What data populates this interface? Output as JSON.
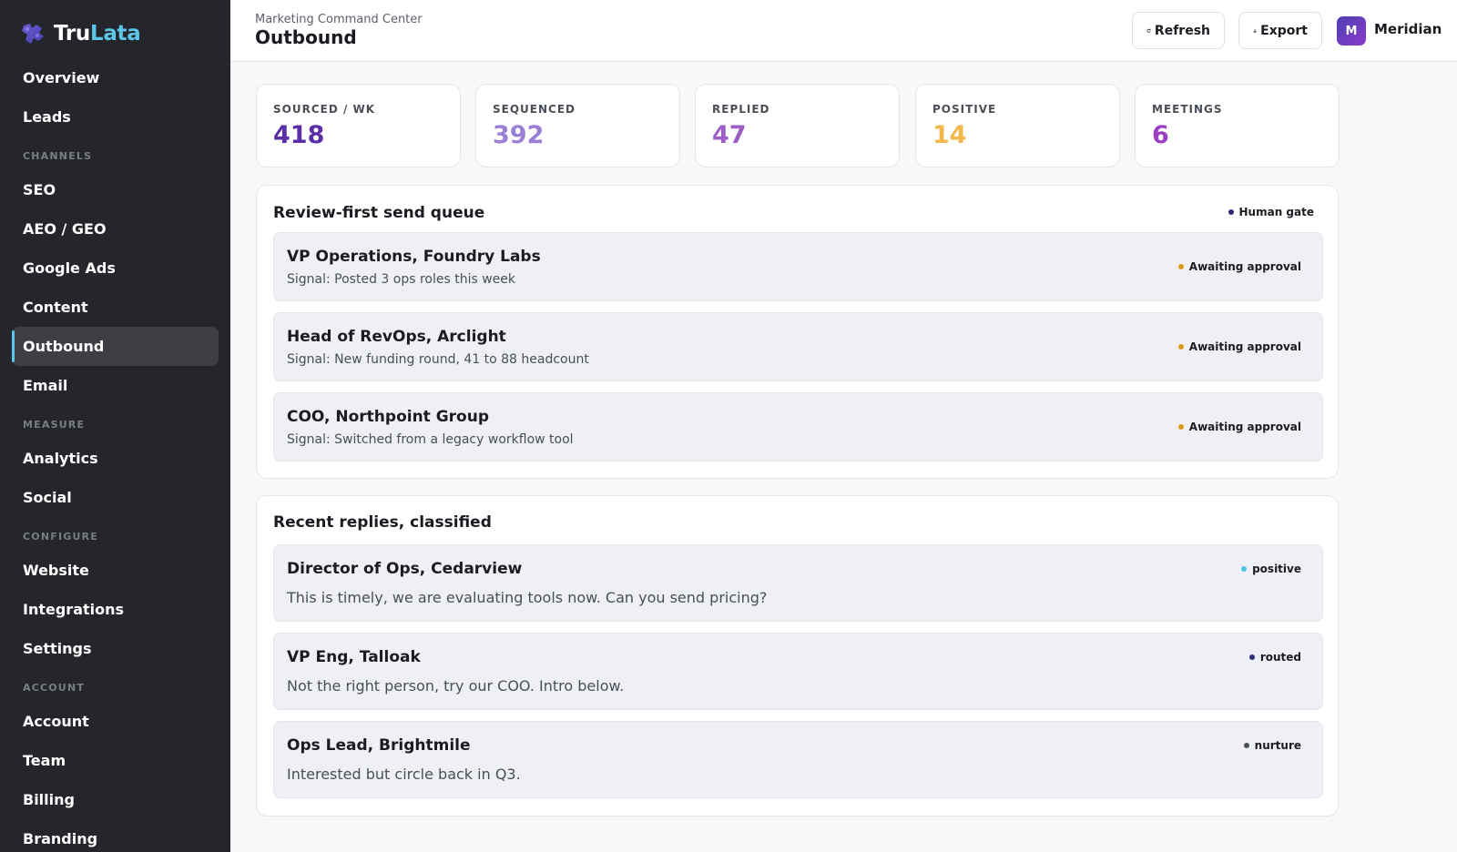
{
  "brand": {
    "name_part1": "Tru",
    "name_part2": "Lata",
    "logo_icon": "puzzle-logo-icon",
    "accent_color": "#5cc6e8"
  },
  "sidebar": {
    "items_top": [
      {
        "label": "Overview"
      },
      {
        "label": "Leads"
      }
    ],
    "sections": [
      {
        "heading": "CHANNELS",
        "items": [
          {
            "label": "SEO"
          },
          {
            "label": "AEO / GEO"
          },
          {
            "label": "Google Ads"
          },
          {
            "label": "Content"
          },
          {
            "label": "Outbound",
            "active": true
          },
          {
            "label": "Email"
          }
        ]
      },
      {
        "heading": "MEASURE",
        "items": [
          {
            "label": "Analytics"
          },
          {
            "label": "Social"
          }
        ]
      },
      {
        "heading": "CONFIGURE",
        "items": [
          {
            "label": "Website"
          },
          {
            "label": "Integrations"
          },
          {
            "label": "Settings"
          }
        ]
      },
      {
        "heading": "ACCOUNT",
        "items": [
          {
            "label": "Account"
          },
          {
            "label": "Team"
          },
          {
            "label": "Billing"
          },
          {
            "label": "Branding"
          }
        ]
      }
    ]
  },
  "header": {
    "breadcrumb": "Marketing Command Center",
    "title": "Outbound",
    "refresh_label": "Refresh",
    "refresh_icon": "refresh-icon",
    "export_label": "Export",
    "export_icon": "arrow-down-icon",
    "avatar_initial": "M",
    "org_name": "Meridian"
  },
  "stats": [
    {
      "label": "SOURCED / WK",
      "value": "418",
      "color": "#5b2ea8"
    },
    {
      "label": "SEQUENCED",
      "value": "392",
      "color": "#9b7fd4"
    },
    {
      "label": "REPLIED",
      "value": "47",
      "color": "#9b5fc6"
    },
    {
      "label": "POSITIVE",
      "value": "14",
      "color": "#f2b84b"
    },
    {
      "label": "MEETINGS",
      "value": "6",
      "color": "#9b3fc2"
    }
  ],
  "queue": {
    "title": "Review-first send queue",
    "gate_label": "Human gate",
    "gate_color": "#2e2a7a",
    "items": [
      {
        "title": "VP Operations, Foundry Labs",
        "signal": "Signal: Posted 3 ops roles this week",
        "status": "Awaiting approval",
        "status_color": "#d99a1e"
      },
      {
        "title": "Head of RevOps, Arclight",
        "signal": "Signal: New funding round, 41 to 88 headcount",
        "status": "Awaiting approval",
        "status_color": "#d99a1e"
      },
      {
        "title": "COO, Northpoint Group",
        "signal": "Signal: Switched from a legacy workflow tool",
        "status": "Awaiting approval",
        "status_color": "#d99a1e"
      }
    ]
  },
  "replies": {
    "title": "Recent replies, classified",
    "items": [
      {
        "title": "Director of Ops, Cedarview",
        "text": "This is timely, we are evaluating tools now. Can you send pricing?",
        "tag": "positive",
        "tag_color": "#4ec3e6"
      },
      {
        "title": "VP Eng, Talloak",
        "text": "Not the right person, try our COO. Intro below.",
        "tag": "routed",
        "tag_color": "#2e2a7a"
      },
      {
        "title": "Ops Lead, Brightmile",
        "text": "Interested but circle back in Q3.",
        "tag": "nurture",
        "tag_color": "#4a4e57"
      }
    ]
  }
}
